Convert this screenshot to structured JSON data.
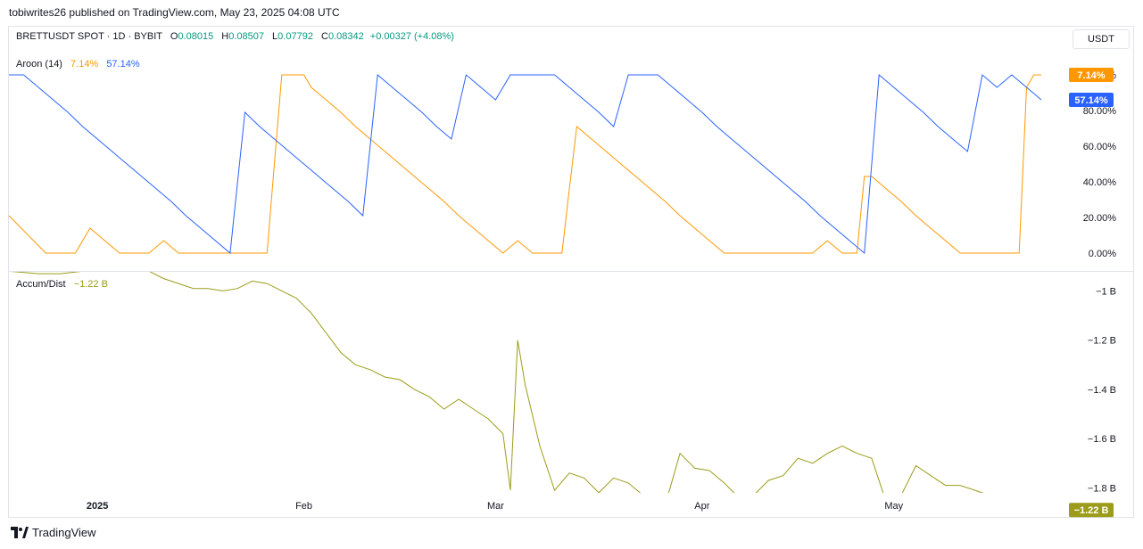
{
  "header": {
    "published": "tobiwrites26 published on TradingView.com, May 23, 2025 04:08 UTC"
  },
  "symbol": {
    "name": "BRETTUSDT SPOT · 1D · BYBIT",
    "o_label": "O",
    "o": "0.08015",
    "h_label": "H",
    "h": "0.08507",
    "l_label": "L",
    "l": "0.07792",
    "c_label": "C",
    "c": "0.08342",
    "change": "+0.00327 (+4.08%)",
    "currency": "USDT"
  },
  "logo": {
    "text": "TradingView"
  },
  "colors": {
    "aroon_up": "#ff9800",
    "aroon_down": "#2962ff",
    "accum": "#9c9c1a",
    "grid": "#e0e3eb",
    "text": "#131722",
    "positive": "#089981"
  },
  "chart_data": [
    {
      "type": "line",
      "title": "Aroon (14)",
      "legend_values": [
        "7.14%",
        "57.14%"
      ],
      "y_ticks": [
        "100.00%",
        "80.00%",
        "60.00%",
        "40.00%",
        "20.00%",
        "0.00%"
      ],
      "ylim": [
        0,
        100
      ],
      "last_value_labels": [
        "57.14%",
        "7.14%"
      ],
      "x_range": [
        0,
        140
      ],
      "series": [
        {
          "color": "#ff9800",
          "points": [
            [
              0,
              21
            ],
            [
              5,
              0
            ],
            [
              7,
              0
            ],
            [
              9,
              0
            ],
            [
              11,
              14
            ],
            [
              13,
              7
            ],
            [
              15,
              0
            ],
            [
              17,
              0
            ],
            [
              19,
              0
            ],
            [
              21,
              7
            ],
            [
              23,
              0
            ],
            [
              25,
              0
            ],
            [
              27,
              0
            ],
            [
              29,
              0
            ],
            [
              31,
              0
            ],
            [
              33,
              0
            ],
            [
              35,
              0
            ],
            [
              36,
              50
            ],
            [
              37,
              100
            ],
            [
              38,
              100
            ],
            [
              39,
              100
            ],
            [
              40,
              100
            ],
            [
              41,
              93
            ],
            [
              43,
              86
            ],
            [
              45,
              79
            ],
            [
              47,
              71
            ],
            [
              49,
              64
            ],
            [
              51,
              57
            ],
            [
              53,
              50
            ],
            [
              55,
              43
            ],
            [
              57,
              36
            ],
            [
              59,
              29
            ],
            [
              61,
              21
            ],
            [
              63,
              14
            ],
            [
              65,
              7
            ],
            [
              67,
              0
            ],
            [
              69,
              7
            ],
            [
              71,
              0
            ],
            [
              73,
              0
            ],
            [
              75,
              0
            ],
            [
              76,
              36
            ],
            [
              77,
              71
            ],
            [
              79,
              64
            ],
            [
              81,
              57
            ],
            [
              83,
              50
            ],
            [
              85,
              43
            ],
            [
              87,
              36
            ],
            [
              89,
              29
            ],
            [
              91,
              21
            ],
            [
              93,
              14
            ],
            [
              95,
              7
            ],
            [
              97,
              0
            ],
            [
              99,
              0
            ],
            [
              101,
              0
            ],
            [
              103,
              0
            ],
            [
              105,
              0
            ],
            [
              107,
              0
            ],
            [
              109,
              0
            ],
            [
              111,
              7
            ],
            [
              113,
              0
            ],
            [
              115,
              0
            ],
            [
              116,
              43
            ],
            [
              117,
              43
            ],
            [
              119,
              36
            ],
            [
              121,
              29
            ],
            [
              123,
              21
            ],
            [
              125,
              14
            ],
            [
              127,
              7
            ],
            [
              129,
              0
            ],
            [
              131,
              0
            ],
            [
              133,
              0
            ],
            [
              135,
              0
            ],
            [
              137,
              0
            ],
            [
              138,
              93
            ],
            [
              139,
              100
            ],
            [
              140,
              100
            ]
          ]
        },
        {
          "color": "#2962ff",
          "points": [
            [
              0,
              100
            ],
            [
              2,
              100
            ],
            [
              4,
              93
            ],
            [
              6,
              86
            ],
            [
              8,
              79
            ],
            [
              10,
              71
            ],
            [
              12,
              64
            ],
            [
              14,
              57
            ],
            [
              16,
              50
            ],
            [
              18,
              43
            ],
            [
              20,
              36
            ],
            [
              22,
              29
            ],
            [
              24,
              21
            ],
            [
              26,
              14
            ],
            [
              28,
              7
            ],
            [
              30,
              0
            ],
            [
              32,
              79
            ],
            [
              34,
              71
            ],
            [
              36,
              64
            ],
            [
              38,
              57
            ],
            [
              40,
              50
            ],
            [
              42,
              43
            ],
            [
              44,
              36
            ],
            [
              46,
              29
            ],
            [
              48,
              21
            ],
            [
              50,
              100
            ],
            [
              52,
              93
            ],
            [
              54,
              86
            ],
            [
              56,
              79
            ],
            [
              58,
              71
            ],
            [
              60,
              64
            ],
            [
              62,
              100
            ],
            [
              64,
              93
            ],
            [
              66,
              86
            ],
            [
              68,
              100
            ],
            [
              70,
              100
            ],
            [
              72,
              100
            ],
            [
              74,
              100
            ],
            [
              76,
              93
            ],
            [
              78,
              86
            ],
            [
              80,
              79
            ],
            [
              82,
              71
            ],
            [
              84,
              100
            ],
            [
              86,
              100
            ],
            [
              88,
              100
            ],
            [
              90,
              93
            ],
            [
              92,
              86
            ],
            [
              94,
              79
            ],
            [
              96,
              71
            ],
            [
              98,
              64
            ],
            [
              100,
              57
            ],
            [
              102,
              50
            ],
            [
              104,
              43
            ],
            [
              106,
              36
            ],
            [
              108,
              29
            ],
            [
              110,
              21
            ],
            [
              112,
              14
            ],
            [
              114,
              7
            ],
            [
              116,
              0
            ],
            [
              118,
              100
            ],
            [
              120,
              93
            ],
            [
              122,
              86
            ],
            [
              124,
              79
            ],
            [
              126,
              71
            ],
            [
              128,
              64
            ],
            [
              130,
              57
            ],
            [
              132,
              100
            ],
            [
              134,
              93
            ],
            [
              136,
              100
            ],
            [
              138,
              93
            ],
            [
              140,
              86
            ]
          ]
        }
      ]
    },
    {
      "type": "line",
      "title": "Accum/Dist",
      "legend_values": [
        "−1.22 B"
      ],
      "y_ticks": [
        "−1 B",
        "−1.2 B",
        "−1.4 B",
        "−1.6 B",
        "−1.8 B"
      ],
      "ylim": [
        -1.9,
        -0.85
      ],
      "last_value_labels": [
        "−1.22 B"
      ],
      "x_range": [
        0,
        140
      ],
      "series": [
        {
          "color": "#9c9c1a",
          "points": [
            [
              0,
              -0.92
            ],
            [
              4,
              -0.93
            ],
            [
              7,
              -0.93
            ],
            [
              10,
              -0.92
            ],
            [
              12,
              -0.91
            ],
            [
              14,
              -0.91
            ],
            [
              17,
              -0.91
            ],
            [
              19,
              -0.92
            ],
            [
              21,
              -0.95
            ],
            [
              23,
              -0.97
            ],
            [
              25,
              -0.99
            ],
            [
              27,
              -0.99
            ],
            [
              29,
              -1.0
            ],
            [
              31,
              -0.99
            ],
            [
              33,
              -0.96
            ],
            [
              35,
              -0.97
            ],
            [
              37,
              -1.0
            ],
            [
              39,
              -1.03
            ],
            [
              41,
              -1.09
            ],
            [
              43,
              -1.17
            ],
            [
              45,
              -1.25
            ],
            [
              47,
              -1.3
            ],
            [
              49,
              -1.32
            ],
            [
              51,
              -1.35
            ],
            [
              53,
              -1.36
            ],
            [
              55,
              -1.4
            ],
            [
              57,
              -1.43
            ],
            [
              59,
              -1.48
            ],
            [
              61,
              -1.44
            ],
            [
              63,
              -1.48
            ],
            [
              65,
              -1.52
            ],
            [
              67,
              -1.58
            ],
            [
              68,
              -1.81
            ],
            [
              69,
              -1.2
            ],
            [
              70,
              -1.38
            ],
            [
              72,
              -1.63
            ],
            [
              74,
              -1.81
            ],
            [
              76,
              -1.74
            ],
            [
              78,
              -1.76
            ],
            [
              80,
              -1.82
            ],
            [
              82,
              -1.76
            ],
            [
              84,
              -1.78
            ],
            [
              86,
              -1.83
            ],
            [
              88,
              -1.87
            ],
            [
              89,
              -1.87
            ],
            [
              91,
              -1.66
            ],
            [
              93,
              -1.72
            ],
            [
              95,
              -1.73
            ],
            [
              97,
              -1.78
            ],
            [
              99,
              -1.84
            ],
            [
              101,
              -1.83
            ],
            [
              103,
              -1.77
            ],
            [
              105,
              -1.75
            ],
            [
              107,
              -1.68
            ],
            [
              109,
              -1.7
            ],
            [
              111,
              -1.66
            ],
            [
              113,
              -1.63
            ],
            [
              115,
              -1.66
            ],
            [
              117,
              -1.68
            ],
            [
              119,
              -1.86
            ],
            [
              121,
              -1.83
            ],
            [
              123,
              -1.71
            ],
            [
              125,
              -1.75
            ],
            [
              127,
              -1.79
            ],
            [
              129,
              -1.79
            ],
            [
              131,
              -1.81
            ],
            [
              133,
              -1.83
            ],
            [
              135,
              -1.85
            ],
            [
              137,
              -1.87
            ],
            [
              140,
              -1.89
            ]
          ]
        }
      ]
    }
  ],
  "x_axis": {
    "labels": [
      {
        "text": "2025",
        "x": 12,
        "bold": true
      },
      {
        "text": "Feb",
        "x": 40
      },
      {
        "text": "Mar",
        "x": 66
      },
      {
        "text": "Apr",
        "x": 94
      },
      {
        "text": "May",
        "x": 120
      }
    ]
  }
}
